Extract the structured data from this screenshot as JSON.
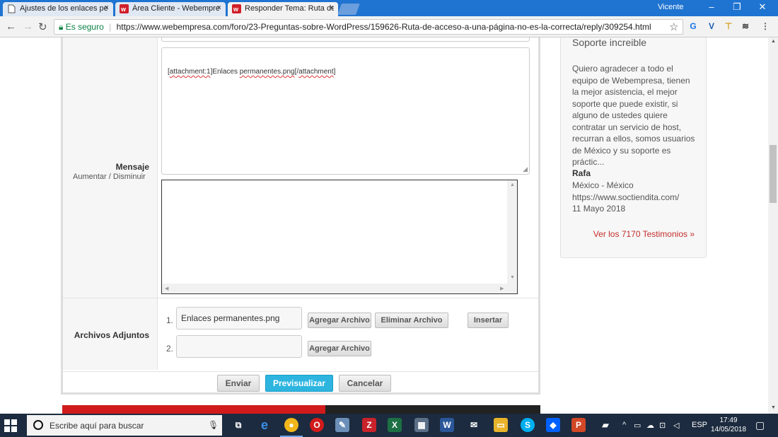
{
  "browser": {
    "tabs": [
      {
        "label": "Ajustes de los enlaces pe",
        "icon": "page-icon",
        "active": false
      },
      {
        "label": "Área Cliente - Webempre",
        "icon": "webempresa-logo-icon",
        "active": false
      },
      {
        "label": "Responder Tema: Ruta de",
        "icon": "webempresa-logo-icon",
        "active": true
      }
    ],
    "tab_close_glyph": "×",
    "user": "Vicente",
    "window_controls": {
      "minimize": "–",
      "maximize": "❐",
      "close": "✕"
    },
    "secure_label": "Es seguro",
    "url": "https://www.webempresa.com/foro/23-Preguntas-sobre-WordPress/159626-Ruta-de-acceso-a-una-página-no-es-la-correcta/reply/309254.html"
  },
  "form": {
    "message_label": "Mensaje",
    "increase_label": "Aumentar /",
    "decrease_label": "Disminuir",
    "message_text_pre": "[",
    "message_text_a": "attachment:1",
    "message_text_b": "]Enlaces ",
    "message_text_c": "permanentes.png",
    "message_text_d": "[/",
    "message_text_e": "attachment",
    "message_text_f": "]",
    "attachments_label": "Archivos Adjuntos",
    "attachments": [
      {
        "index": "1.",
        "filename": "Enlaces permanentes.png",
        "add_label": "Agregar Archivo",
        "remove_label": "Eliminar Archivo",
        "insert_label": "Insertar"
      },
      {
        "index": "2.",
        "filename": "",
        "add_label": "Agregar Archivo"
      }
    ],
    "submit_label": "Enviar",
    "preview_label": "Previsualizar",
    "cancel_label": "Cancelar"
  },
  "sidebar": {
    "title": "Soporte increible",
    "quote": "Quiero agradecer a todo el equipo de Webempresa, tienen la mejor asistencia, el mejor soporte que puede existir, si alguno de ustedes quiere contratar un servicio de host, recurran a ellos, somos usuarios de México y su soporte es práctic...",
    "author": "Rafa",
    "location": "México - México",
    "website": "https://www.soctiendita.com/",
    "date": "11 Mayo 2018",
    "link": "Ver los 7170 Testimonios »"
  },
  "taskbar": {
    "search_placeholder": "Escribe aquí para buscar",
    "language": "ESP",
    "time": "17:49",
    "date": "14/05/2018"
  },
  "colors": {
    "chrome_blue": "#1f74d1",
    "primary_button": "#2db5e0",
    "sidebar_link": "#c32d2d",
    "banner_red": "#d11b1b",
    "taskbar": "#1c2b3f"
  }
}
